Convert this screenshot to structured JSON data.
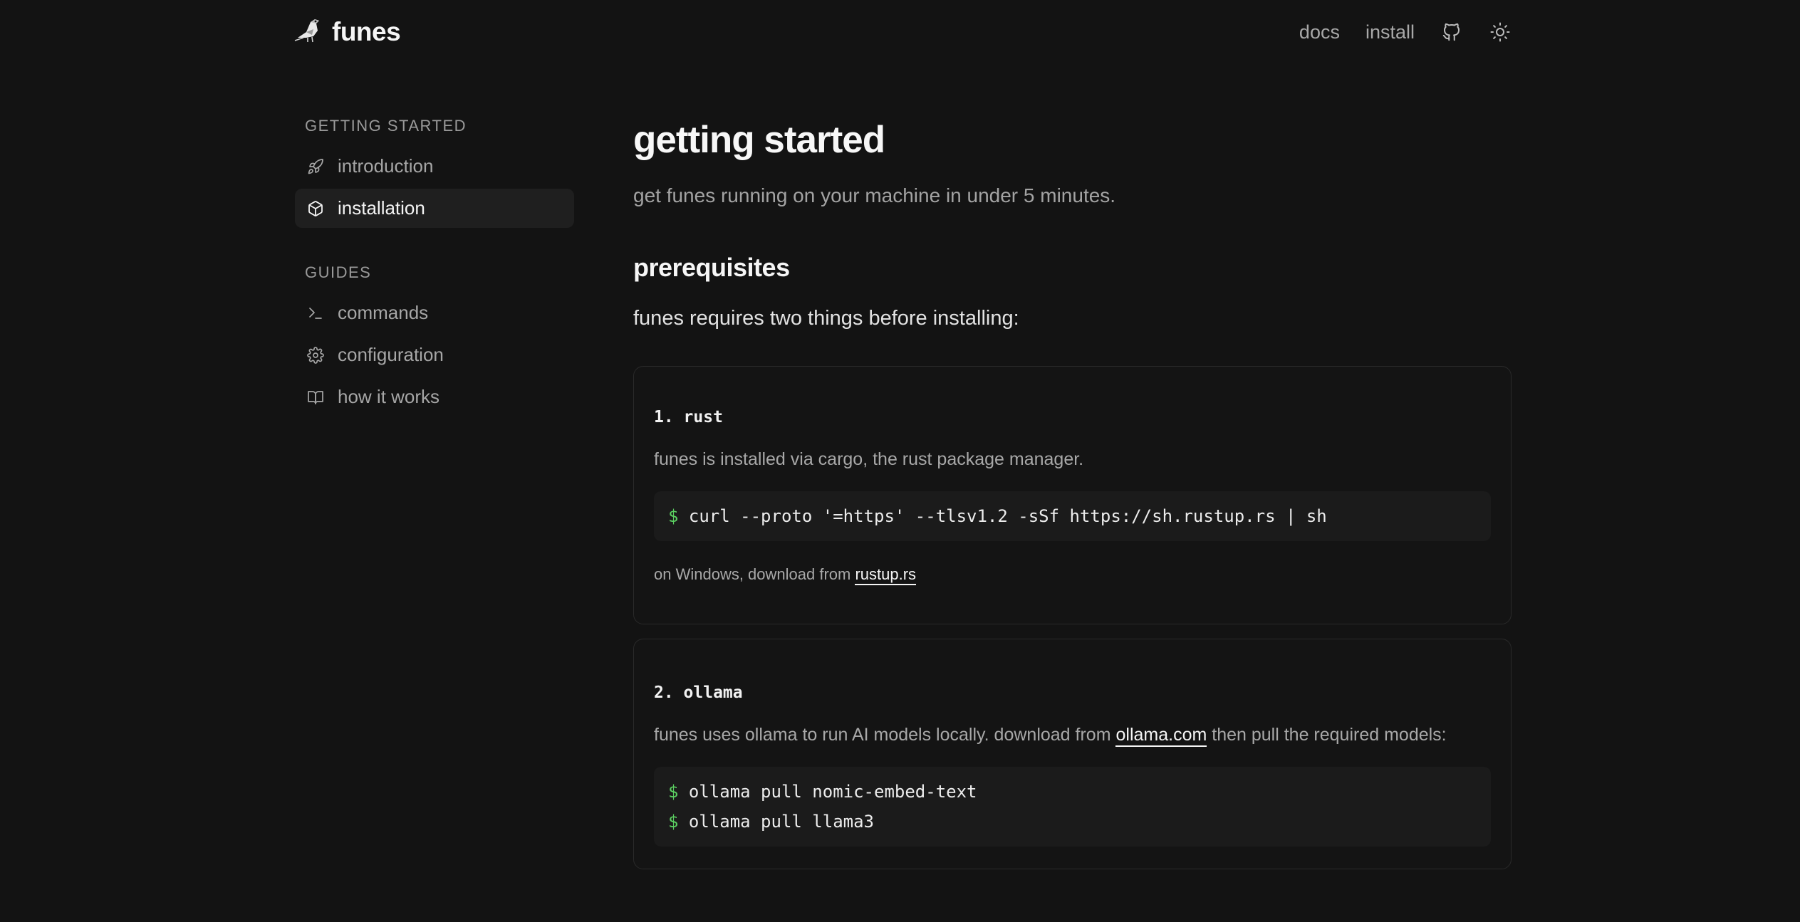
{
  "header": {
    "brand": "funes",
    "nav": [
      {
        "label": "docs"
      },
      {
        "label": "install"
      }
    ],
    "icons": [
      "github-icon",
      "sun-icon"
    ]
  },
  "sidebar": {
    "groups": [
      {
        "heading": "GETTING STARTED",
        "items": [
          {
            "label": "introduction",
            "icon": "rocket-icon"
          },
          {
            "label": "installation",
            "icon": "package-icon",
            "active": true
          }
        ]
      },
      {
        "heading": "GUIDES",
        "items": [
          {
            "label": "commands",
            "icon": "terminal-icon"
          },
          {
            "label": "configuration",
            "icon": "gear-icon"
          },
          {
            "label": "how it works",
            "icon": "book-icon"
          }
        ]
      }
    ]
  },
  "main": {
    "title": "getting started",
    "subtitle": "get funes running on your machine in under 5 minutes.",
    "section_title": "prerequisites",
    "lead": "funes requires two things before installing:",
    "cards": [
      {
        "title": "1. rust",
        "text": "funes is installed via cargo, the rust package manager.",
        "prompt": "$",
        "commands": [
          "curl --proto '=https' --tlsv1.2 -sSf https://sh.rustup.rs | sh"
        ],
        "note_prefix": "on Windows, download from ",
        "note_link": "rustup.rs"
      },
      {
        "title": "2. ollama",
        "text_prefix": "funes uses ollama to run AI models locally. download from ",
        "text_link": "ollama.com",
        "text_suffix": " then pull the required models:",
        "prompt": "$",
        "commands": [
          "ollama pull nomic-embed-text",
          "ollama pull llama3"
        ]
      }
    ]
  },
  "colors": {
    "background": "#131313",
    "prompt": "#5bcf61",
    "active_bg": "#1f1f1f",
    "border": "#2a2a2a"
  }
}
